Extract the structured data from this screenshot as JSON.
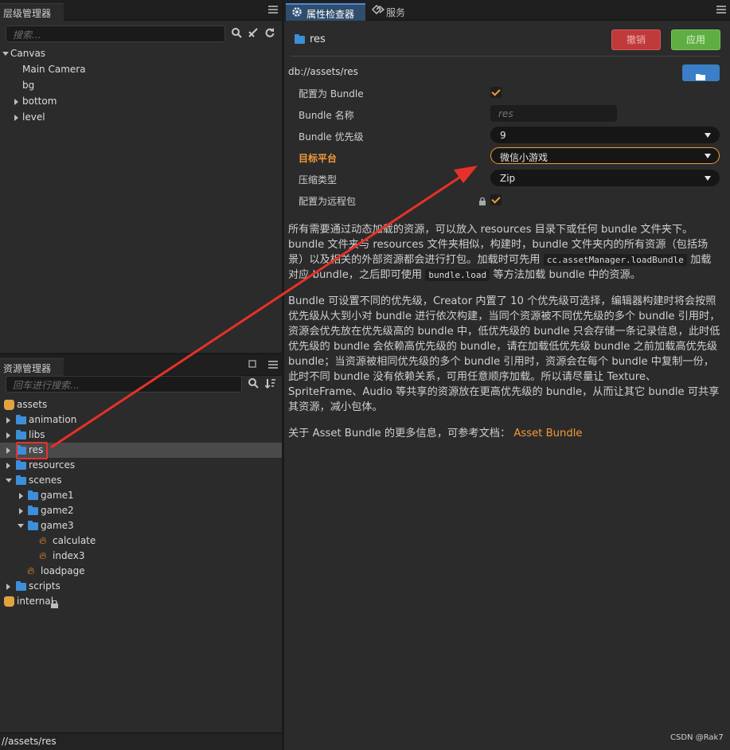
{
  "hierarchy": {
    "title": "层级管理器",
    "search_placeholder": "搜索...",
    "nodes": [
      "Canvas",
      "Main Camera",
      "bg",
      "bottom",
      "level"
    ]
  },
  "assets": {
    "title": "资源管理器",
    "search_placeholder": "回车进行搜索...",
    "items": [
      "assets",
      "animation",
      "libs",
      "res",
      "resources",
      "scenes",
      "game1",
      "game2",
      "game3",
      "calculate",
      "index3",
      "loadpage",
      "scripts",
      "internal"
    ],
    "status_path": "//assets/res"
  },
  "inspector": {
    "tab_label": "属性检查器",
    "service_tab": "服务",
    "asset_name": "res",
    "revert_label": "撤销",
    "apply_label": "应用",
    "db_path": "db://assets/res",
    "props": {
      "bundle_config_label": "配置为 Bundle",
      "bundle_name_label": "Bundle 名称",
      "bundle_name_placeholder": "res",
      "priority_label": "Bundle 优先级",
      "priority_value": "9",
      "target_label": "目标平台",
      "target_value": "微信小游戏",
      "compress_label": "压缩类型",
      "compress_value": "Zip",
      "remote_label": "配置为远程包"
    },
    "desc1_a": "所有需要通过动态加载的资源，可以放入 resources 目录下或任何 bundle 文件夹下。bundle 文件夹与 resources 文件夹相似，构建时，bundle 文件夹内的所有资源（包括场景）以及相关的外部资源都会进行打包。加载时可先用",
    "desc1_code1": "cc.assetManager.loadBundle",
    "desc1_b": "加载对应 bundle，之后即可使用",
    "desc1_code2": "bundle.load",
    "desc1_c": "等方法加载 bundle 中的资源。",
    "desc2": "Bundle 可设置不同的优先级，Creator 内置了 10 个优先级可选择，编辑器构建时将会按照优先级从大到小对 bundle 进行依次构建，当同个资源被不同优先级的多个 bundle 引用时，资源会优先放在优先级高的 bundle 中，低优先级的 bundle 只会存储一条记录信息，此时低优先级的 bundle 会依赖高优先级的 bundle，请在加载低优先级 bundle 之前加载高优先级 bundle；当资源被相同优先级的多个 bundle 引用时，资源会在每个 bundle 中复制一份，此时不同 bundle 没有依赖关系，可用任意顺序加载。所以请尽量让 Texture、SpriteFrame、Audio 等共享的资源放在更高优先级的 bundle，从而让其它 bundle 可共享其资源，减小包体。",
    "more_info": "关于 Asset Bundle 的更多信息，可参考文档：",
    "more_link": "Asset Bundle"
  },
  "watermark": "CSDN @Rak7",
  "colors": {
    "accent": "#f29a3b",
    "annotation": "#e8302a",
    "revert": "#c0393b",
    "apply": "#5fae43",
    "folder": "#3c8fd8"
  }
}
